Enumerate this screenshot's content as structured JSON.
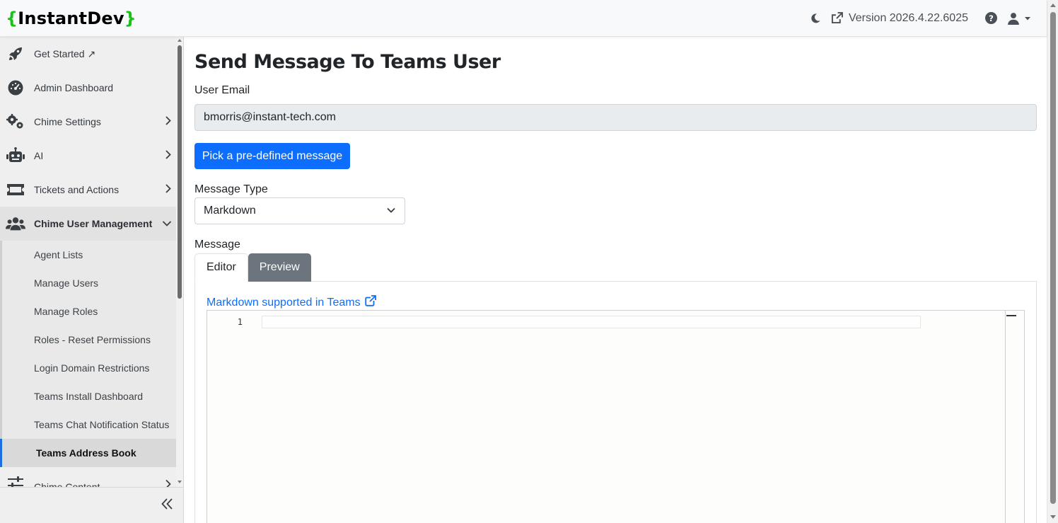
{
  "app": {
    "brand_open": "{",
    "brand_name": "InstantDev",
    "brand_close": "}",
    "version_label": "Version 2026.4.22.6025"
  },
  "header_icons": [
    "moon-icon",
    "external-link-icon",
    "help-icon",
    "user-icon",
    "caret-down-icon"
  ],
  "sidebar": {
    "items": [
      {
        "label": "Get Started ↗",
        "icon": "rocket-icon"
      },
      {
        "label": "Admin Dashboard",
        "icon": "gauge-icon"
      },
      {
        "label": "Chime Settings",
        "icon": "gears-icon"
      },
      {
        "label": "AI",
        "icon": "robot-icon"
      },
      {
        "label": "Tickets and Actions",
        "icon": "ticket-icon"
      },
      {
        "label": "Chime User Management",
        "icon": "users-icon"
      },
      {
        "label": "Chime Content",
        "icon": "sliders-icon"
      }
    ],
    "sub_items": [
      {
        "label": "Agent Lists"
      },
      {
        "label": "Manage Users"
      },
      {
        "label": "Manage Roles"
      },
      {
        "label": "Roles - Reset Permissions"
      },
      {
        "label": "Login Domain Restrictions"
      },
      {
        "label": "Teams Install Dashboard"
      },
      {
        "label": "Teams Chat Notification Status"
      },
      {
        "label": "Teams Address Book"
      }
    ],
    "active_sub_item": "Teams Address Book",
    "collapse_icon": "double-chevron-left-icon"
  },
  "main": {
    "title": "Send Message To Teams User",
    "email_label": "User Email",
    "email_value": "bmorris@instant-tech.com",
    "predefined_button": "Pick a pre-defined message",
    "message_type_label": "Message Type",
    "message_type_value": "Markdown",
    "message_label": "Message",
    "tabs": [
      {
        "label": "Editor",
        "active": true
      },
      {
        "label": "Preview",
        "active": false
      }
    ],
    "markdown_link": "Markdown supported in Teams",
    "editor_line_number": "1"
  },
  "colors": {
    "primary": "#0d6efd",
    "brand_bracket": "#17c317",
    "tab_inactive": "#6c757d"
  }
}
